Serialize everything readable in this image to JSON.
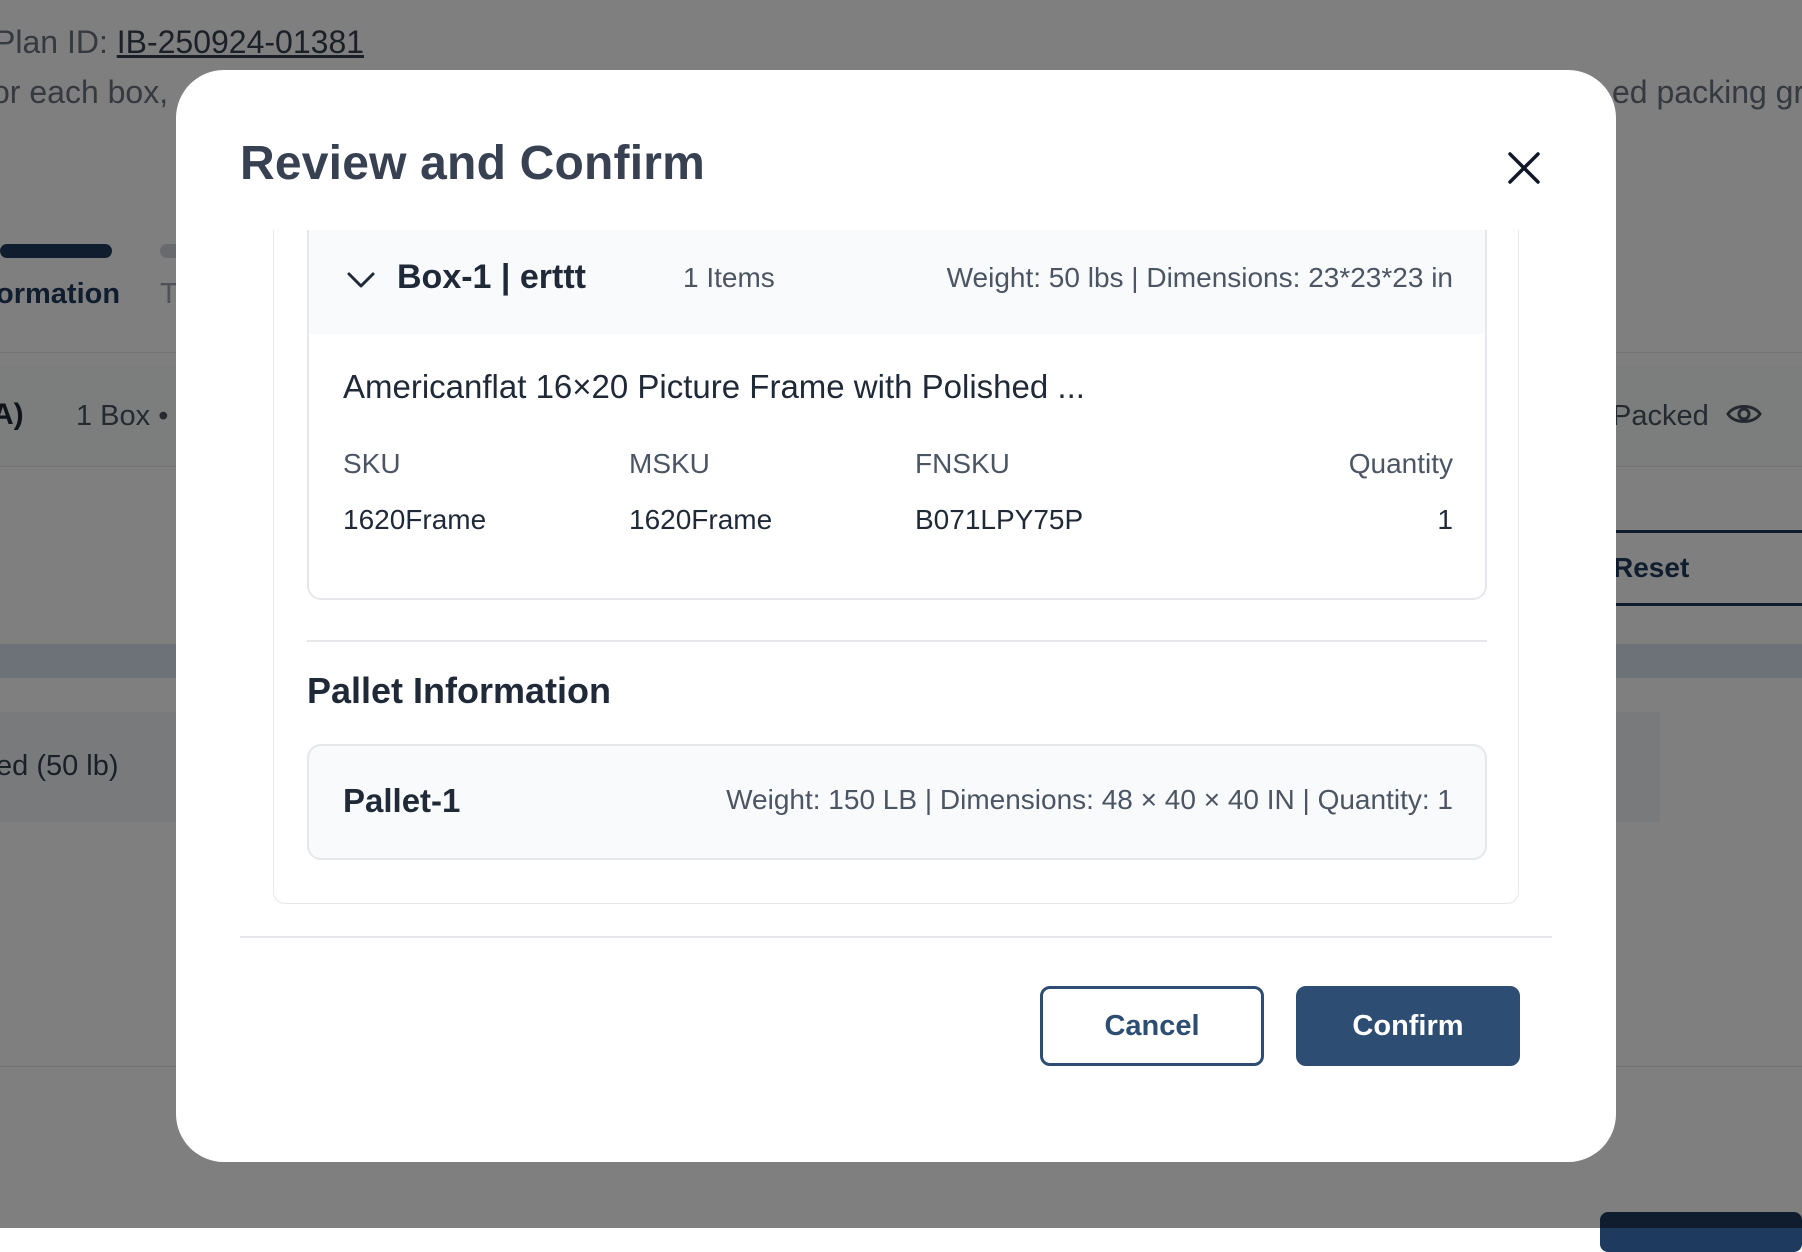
{
  "background": {
    "plan_id_label": "Plan ID: ",
    "plan_id_value": "IB-250924-01381",
    "instruction_left": "or each box, ",
    "instruction_right": "ed packing gr",
    "step_active": "ormation",
    "step_next": "T",
    "shipment_code": "A)",
    "box_count": "1 Box  •",
    "packed_status": "Packed",
    "reset_label": "Reset",
    "weight_summary": "ed  (50 lb)"
  },
  "modal": {
    "title": "Review and Confirm",
    "box": {
      "name": "Box-1 | erttt",
      "items_count": "1 Items",
      "meta": "Weight: 50 lbs | Dimensions: 23*23*23 in",
      "product_name": "Americanflat 16×20 Picture Frame with Polished ...",
      "columns": [
        "SKU",
        "MSKU",
        "FNSKU",
        "Quantity"
      ],
      "row": [
        "1620Frame",
        "1620Frame",
        "B071LPY75P",
        "1"
      ]
    },
    "pallet_section_title": "Pallet Information",
    "pallet": {
      "name": "Pallet-1",
      "meta": "Weight: 150 LB | Dimensions: 48 × 40 × 40 IN | Quantity: 1"
    },
    "cancel_label": "Cancel",
    "confirm_label": "Confirm"
  },
  "colors": {
    "primary": "#2d4d72",
    "overlay": "rgba(0,0,0,0.5)"
  }
}
